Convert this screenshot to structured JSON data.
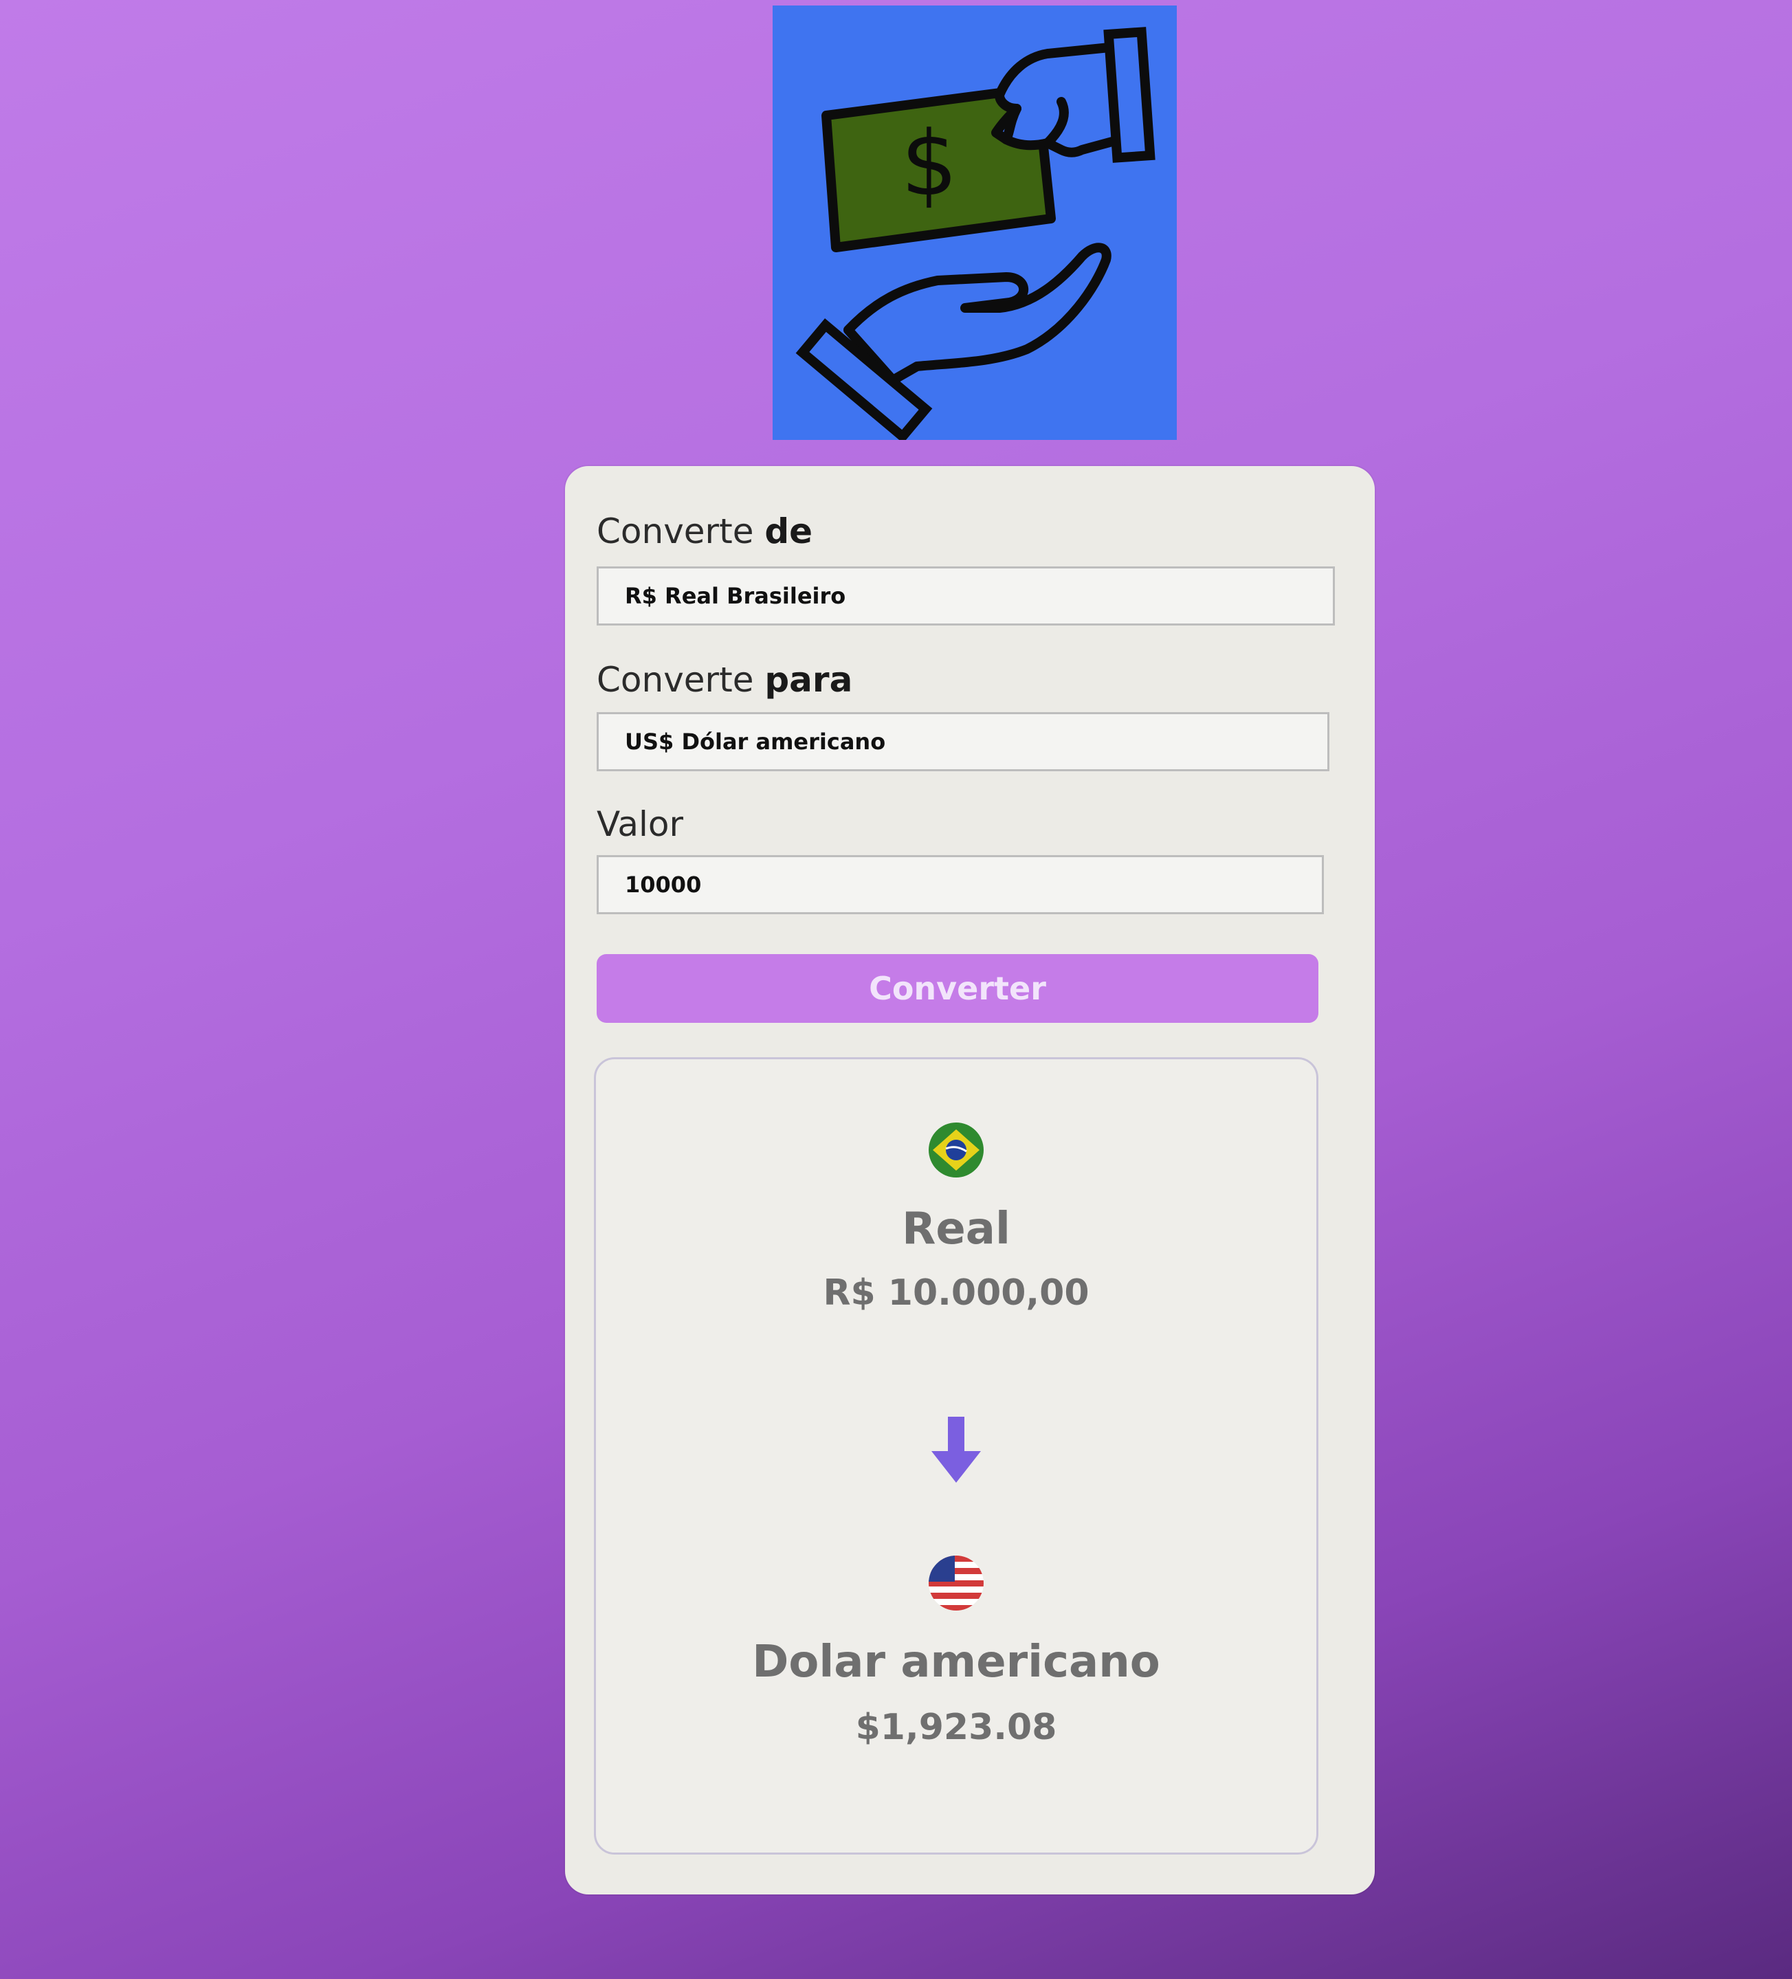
{
  "app": {
    "logo_icon": "hands-exchanging-money-icon",
    "logo_glyph": "$"
  },
  "form": {
    "from_label": "Converte ",
    "from_label_bold": "de",
    "from_value": "R$ Real Brasileiro",
    "to_label": "Converte ",
    "to_label_bold": "para",
    "to_value": "US$ Dólar americano",
    "amount_label": "Valor",
    "amount_value": "10000",
    "convert_button": "Converter"
  },
  "result": {
    "from_flag_icon": "brazil-flag-icon",
    "from_currency_name": "Real",
    "from_amount": "R$ 10.000,00",
    "arrow_icon": "arrow-down-icon",
    "to_flag_icon": "usa-flag-icon",
    "to_currency_name": "Dolar americano",
    "to_amount": "$1,923.08"
  },
  "colors": {
    "background": "#b46ee0",
    "logo_background": "#3f74f0",
    "banknote": "#3e6411",
    "card": "#ecebe6",
    "button": "#c57ce8",
    "arrow": "#7b5fe0"
  }
}
